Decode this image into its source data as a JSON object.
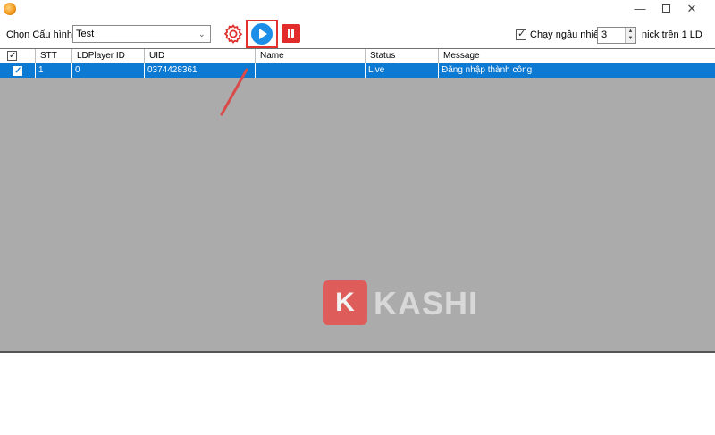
{
  "window": {
    "minimize": "—",
    "maximize": "",
    "close": "✕"
  },
  "toolbar": {
    "config_label": "Chọn Cấu hình",
    "config_value": "Test",
    "random_label": "Chạy ngẫu nhiên",
    "random_checked": true,
    "nick_count": "3",
    "nick_suffix": "nick trên 1  LD"
  },
  "grid": {
    "columns": [
      "STT",
      "LDPlayer ID",
      "UID",
      "Name",
      "Status",
      "Message"
    ],
    "rows": [
      {
        "checked": true,
        "stt": "1",
        "ldplayer_id": "0",
        "uid": "0374428361",
        "name": "",
        "status": "Live",
        "message": "Đăng nhập thành công"
      }
    ]
  },
  "watermark": {
    "letter": "K",
    "text": "KASHI"
  },
  "colors": {
    "selected_row": "#0c79d3",
    "play": "#1d8ee8",
    "pause": "#e22b2b",
    "highlight": "#e0312f",
    "grid_bg": "#ababab"
  }
}
